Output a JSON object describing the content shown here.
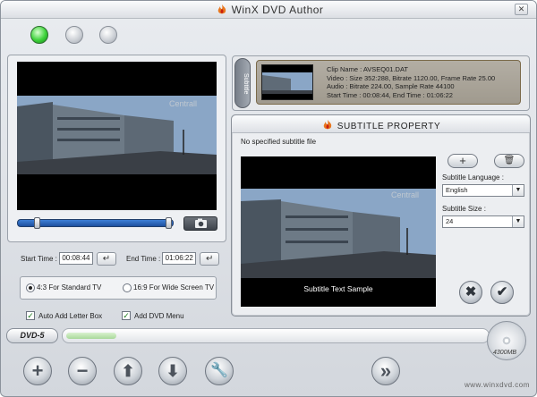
{
  "window": {
    "title": "WinX DVD Author",
    "close_icon": "close-icon"
  },
  "colors": {
    "led_on": "#3dd23a",
    "progress_bar": "#1d4f9e",
    "clip_card_bg": "#a09a8e"
  },
  "status_leds": [
    "on",
    "off",
    "off"
  ],
  "preview": {
    "overlay_text": "Centrall"
  },
  "time": {
    "start_label": "Start Time :",
    "start_value": "00:08:44",
    "end_label": "End Time :",
    "end_value": "01:06:22",
    "enter_glyph": "↵"
  },
  "aspect": {
    "standard_label": "4:3 For Standard TV",
    "wide_label": "16:9 For Wide Screen TV",
    "selected": "standard"
  },
  "options": {
    "letterbox_label": "Auto Add Letter Box",
    "menu_label": "Add DVD Menu",
    "check_glyph": "✓"
  },
  "disc": {
    "type_label": "DVD-5",
    "capacity_label": "4300MB",
    "used_fraction": 0.12
  },
  "toolbar": {
    "add_glyph": "+",
    "remove_glyph": "−",
    "up_glyph": "⬆",
    "down_glyph": "⬇",
    "settings_glyph": "🔧",
    "next_glyph": "»"
  },
  "footer": {
    "url": "www.winxdvd.com"
  },
  "clips": {
    "tab_label": "Subtitle",
    "items": [
      {
        "name_line": "Clip Name : AVSEQ01.DAT",
        "video_line": "Video : Size 352:288, Bitrate 1120.00, Frame Rate 25.00",
        "audio_line": "Audio : Bitrate 224.00, Sample Rate 44100",
        "time_line": "Start Time : 00:08:44, End Time : 01:06:22"
      }
    ]
  },
  "subtitle_dialog": {
    "title": "SUBTITLE PROPERTY",
    "no_file_text": "No specified subtitle file",
    "sample_text": "Subtitle Text Sample",
    "language_label": "Subtitle Language :",
    "language_value": "English",
    "size_label": "Subtitle Size :",
    "size_value": "24",
    "add_glyph": "+",
    "delete_glyph": "🗑",
    "cancel_glyph": "✖",
    "ok_glyph": "✔",
    "dropdown_glyph": "▼"
  }
}
